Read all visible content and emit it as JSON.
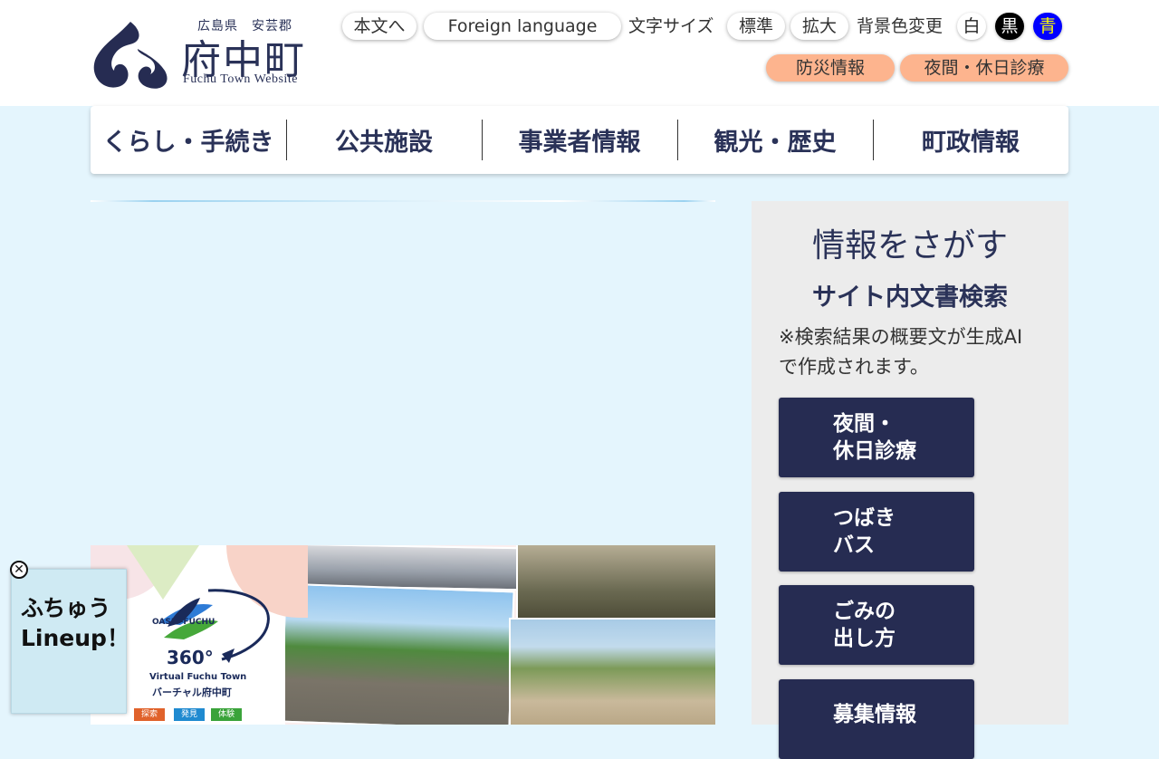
{
  "header": {
    "logo": {
      "prefecture": "広島県　安芸郡",
      "name": "府中町",
      "english": "Fuchu Town Website"
    },
    "utility": {
      "skip_to_content": "本文へ",
      "foreign_language": "Foreign language",
      "font_size_label": "文字サイズ",
      "font_size_standard": "標準",
      "font_size_large": "拡大",
      "bg_color_label": "背景色変更",
      "bg_white": "白",
      "bg_black": "黒",
      "bg_blue": "青"
    },
    "quick_links": {
      "disaster": "防災情報",
      "night_holiday": "夜間・休日診療"
    }
  },
  "global_nav": [
    {
      "label": "くらし・手続き"
    },
    {
      "label": "公共施設"
    },
    {
      "label": "事業者情報"
    },
    {
      "label": "観光・歴史"
    },
    {
      "label": "町政情報"
    }
  ],
  "banner": {
    "brand": "OASIS-FUCHU",
    "degree": "360°",
    "subtitle": "Virtual Fuchu Town",
    "subtitle_jp": "バーチャル府中町",
    "tags": [
      "探索",
      "発見",
      "体験"
    ]
  },
  "floating": {
    "label": "ふちゅう\nLineup！",
    "close": "✕"
  },
  "sidebar": {
    "title": "情報をさがす",
    "search_heading": "サイト内文書検索",
    "note": "※検索結果の概要文が生成AIで作成されます。",
    "buttons": [
      {
        "label": "夜間・\n休日診療"
      },
      {
        "label": "つばき\nバス"
      },
      {
        "label": "ごみの\n出し方"
      },
      {
        "label": "募集情報"
      }
    ]
  },
  "colors": {
    "brand_navy": "#262c52",
    "page_bg": "#e4f5fd",
    "orange_button": "#fdb48e",
    "bg_blue_button": "#0000ff"
  }
}
